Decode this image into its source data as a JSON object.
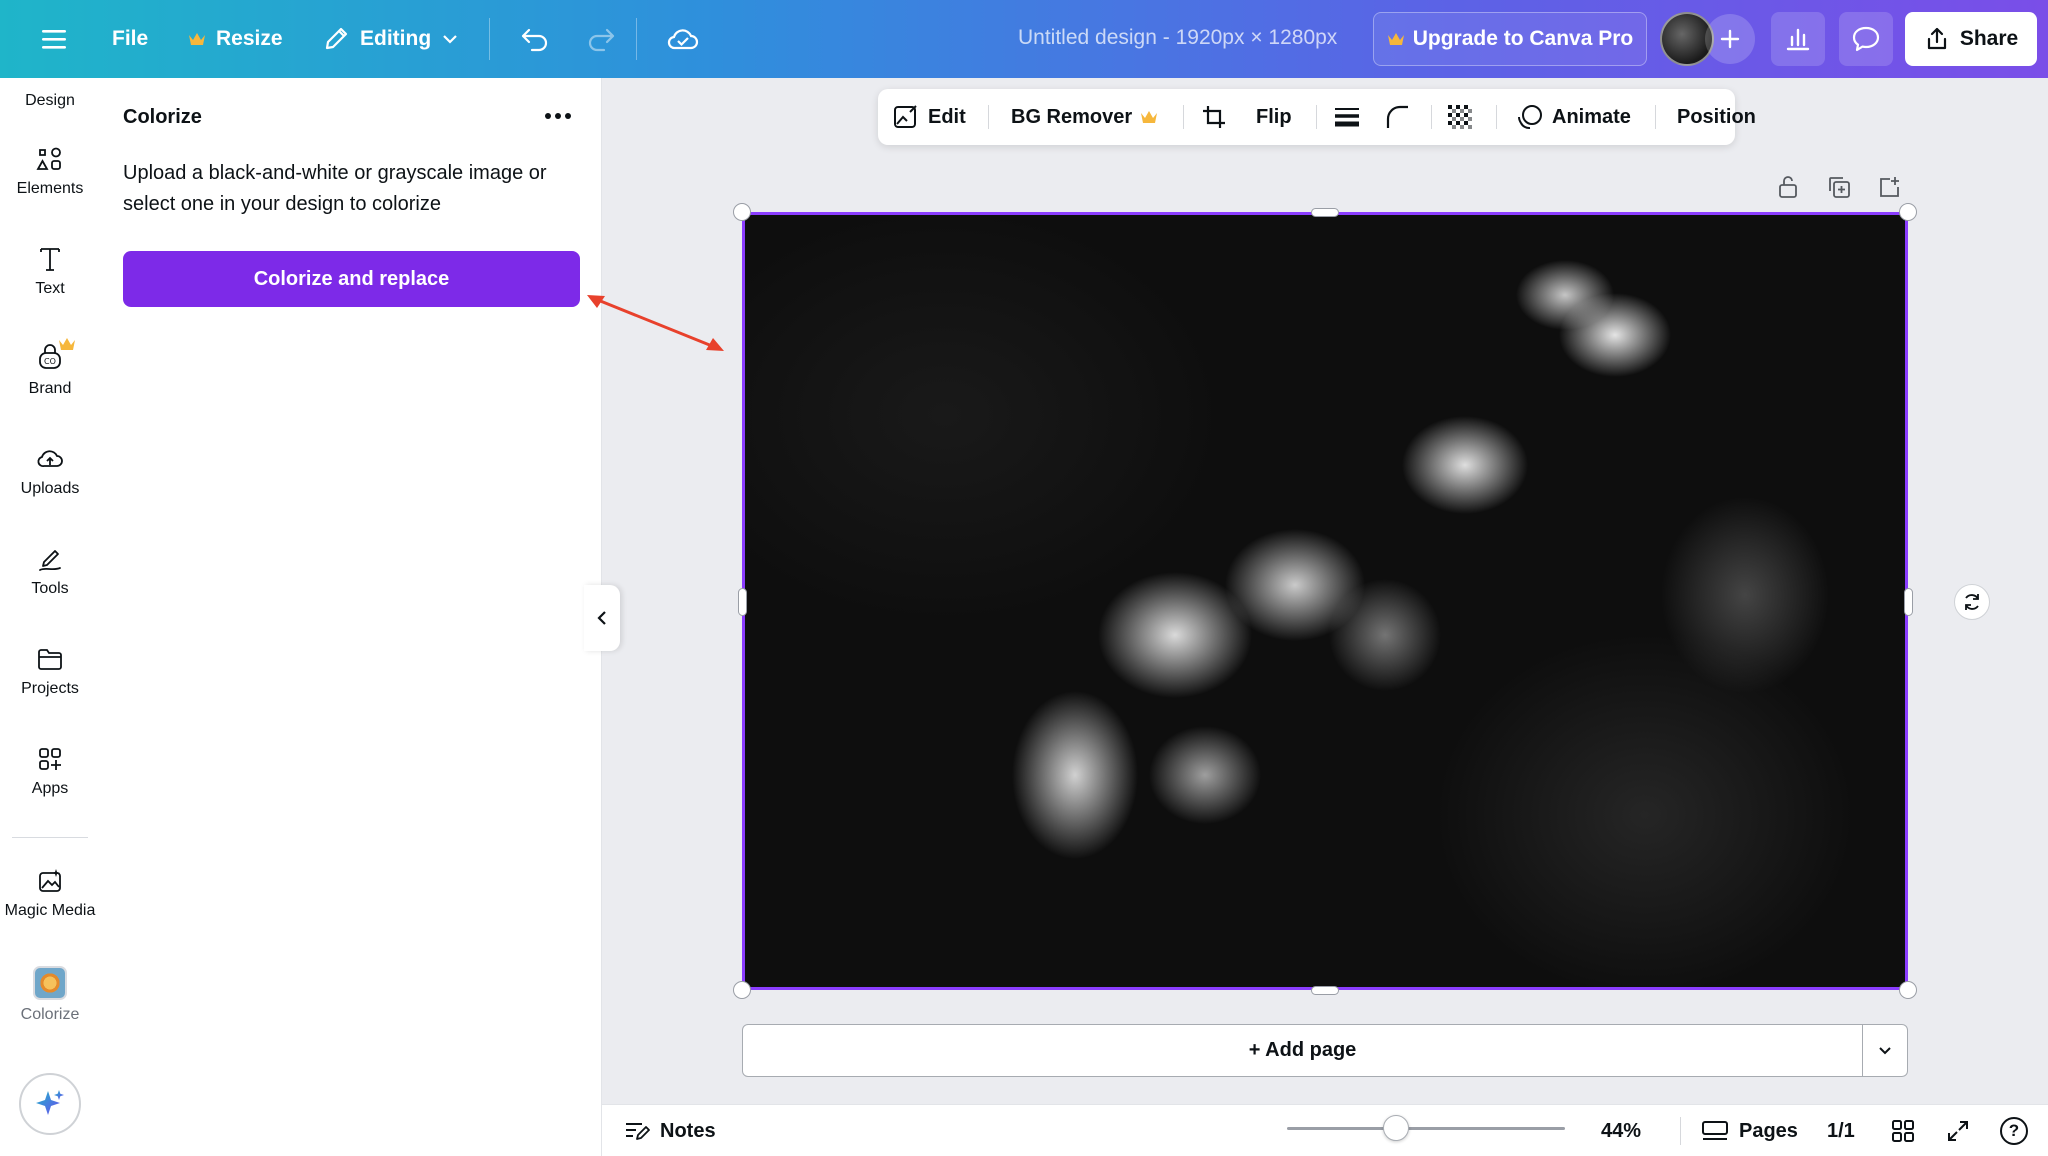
{
  "topbar": {
    "file_label": "File",
    "resize_label": "Resize",
    "editing_label": "Editing",
    "design_title": "Untitled design - 1920px × 1280px",
    "upgrade_label": "Upgrade to Canva Pro",
    "share_label": "Share"
  },
  "rail": {
    "items": [
      {
        "label": "Design",
        "icon": "design-icon"
      },
      {
        "label": "Elements",
        "icon": "elements-icon"
      },
      {
        "label": "Text",
        "icon": "text-icon"
      },
      {
        "label": "Brand",
        "icon": "brand-icon"
      },
      {
        "label": "Uploads",
        "icon": "uploads-icon"
      },
      {
        "label": "Tools",
        "icon": "tools-icon"
      },
      {
        "label": "Projects",
        "icon": "projects-icon"
      },
      {
        "label": "Apps",
        "icon": "apps-icon"
      },
      {
        "label": "Magic Media",
        "icon": "magic-media-icon"
      },
      {
        "label": "Colorize",
        "icon": "colorize-icon"
      }
    ]
  },
  "panel": {
    "title": "Colorize",
    "description": "Upload a black-and-white or grayscale image or select one in your design to colorize",
    "button_label": "Colorize and replace"
  },
  "context_toolbar": {
    "edit_label": "Edit",
    "bg_remover_label": "BG Remover",
    "flip_label": "Flip",
    "animate_label": "Animate",
    "position_label": "Position"
  },
  "canvas": {
    "add_page_label": "+ Add page"
  },
  "bottombar": {
    "notes_label": "Notes",
    "zoom": "44%",
    "pages_label": "Pages",
    "page_count": "1/1",
    "help_label": "?"
  },
  "colors": {
    "accent": "#7d2ae8",
    "selection": "#8b3dff",
    "crown": "#f6b73c",
    "arrow": "#e8412c"
  }
}
